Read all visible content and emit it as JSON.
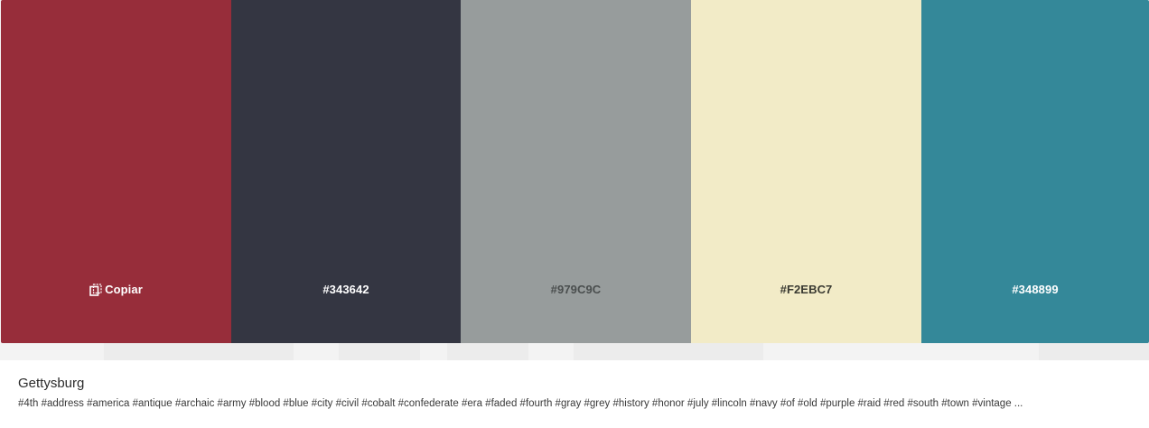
{
  "palette": {
    "swatches": [
      {
        "hex": "#972D3A",
        "label": "Copiar",
        "text_color": "#ffffff",
        "hovered": true
      },
      {
        "hex": "#343642",
        "label": "#343642",
        "text_color": "#ffffff"
      },
      {
        "hex": "#979C9C",
        "label": "#979C9C",
        "text_color": "#4a4e4e"
      },
      {
        "hex": "#F2EBC7",
        "label": "#F2EBC7",
        "text_color": "#3a3a32"
      },
      {
        "hex": "#348899",
        "label": "#348899",
        "text_color": "#ffffff"
      }
    ]
  },
  "info": {
    "title": "Gettysburg",
    "tags": "#4th #address #america #antique #archaic #army #blood #blue #city #civil #cobalt #confederate #era #faded #fourth #gray #grey #history #honor #july #lincoln #navy #of #old #purple #raid #red #south #town #vintage ..."
  }
}
